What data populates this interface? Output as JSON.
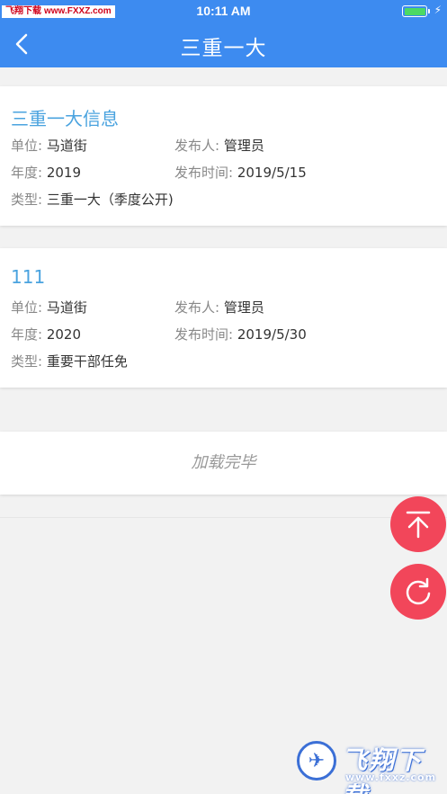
{
  "status_bar": {
    "watermark_left": "飞翔下载",
    "watermark_right": "www.FXXZ.com",
    "time": "10:11 AM"
  },
  "nav": {
    "title": "三重一大",
    "back_icon": "chevron-left-icon"
  },
  "records": [
    {
      "title": "三重一大信息",
      "unit_label": "单位:",
      "unit": "马道街",
      "publisher_label": "发布人:",
      "publisher": "管理员",
      "year_label": "年度:",
      "year": "2019",
      "publish_time_label": "发布时间:",
      "publish_time": "2019/5/15",
      "type_label": "类型:",
      "type": "三重一大（季度公开)"
    },
    {
      "title": "111",
      "unit_label": "单位:",
      "unit": "马道街",
      "publisher_label": "发布人:",
      "publisher": "管理员",
      "year_label": "年度:",
      "year": "2020",
      "publish_time_label": "发布时间:",
      "publish_time": "2019/5/30",
      "type_label": "类型:",
      "type": "重要干部任免"
    }
  ],
  "load_status": "加载完毕",
  "fab": {
    "top_icon": "scroll-to-top-icon",
    "refresh_icon": "refresh-icon"
  },
  "watermark_logo": {
    "text": "飞翔下载",
    "url": "www.fxxz.com"
  },
  "colors": {
    "nav_bg": "#3d8bf0",
    "title_blue": "#4aa3df",
    "fab_red": "#f2465a"
  }
}
